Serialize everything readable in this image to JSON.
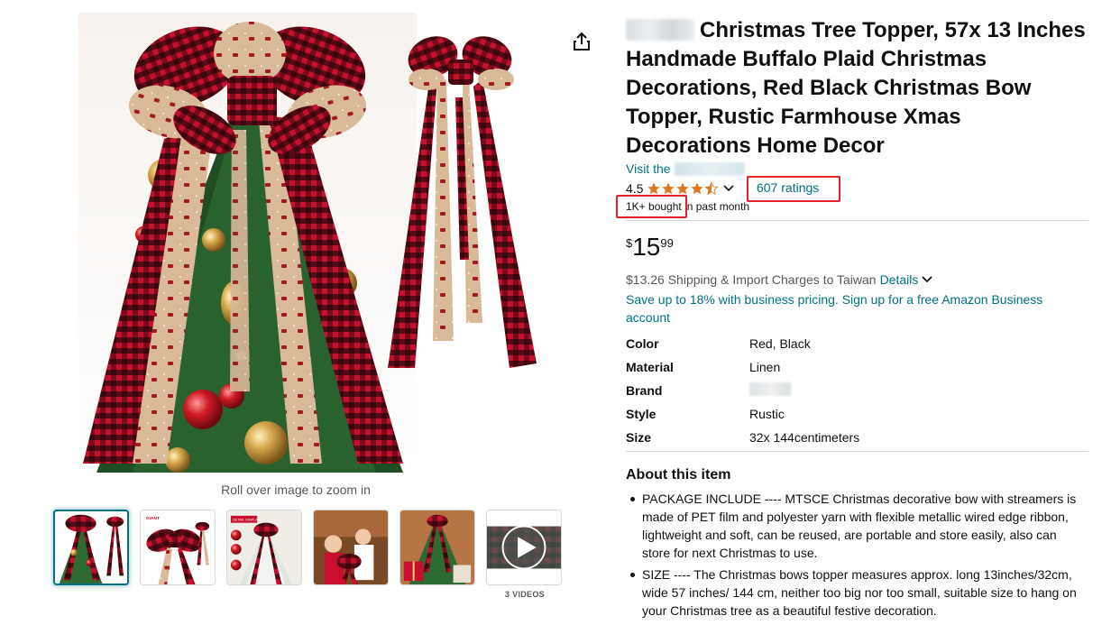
{
  "gallery": {
    "zoom_hint": "Roll over image to zoom in",
    "thumbnail_badges": [
      "GIANT",
      "DETAIL DISPLAY"
    ],
    "videos_label": "3 VIDEOS",
    "thumbnails": [
      "bow-topper-tree",
      "bow-detail",
      "detail-display",
      "family-decorating",
      "gift-scene",
      "video"
    ]
  },
  "product": {
    "title": "Christmas Tree Topper, 57x 13 Inches Handmade Buffalo Plaid Christmas Decorations, Red Black Christmas Bow Topper, Rustic Farmhouse Xmas Decorations Home Decor",
    "visit_store": "Visit the",
    "rating_value": "4.5",
    "ratings_link": "607 ratings",
    "bought_badge": "1K+ bought",
    "bought_suffix": " in past month",
    "price": {
      "symbol": "$",
      "whole": "15",
      "fraction": "99"
    },
    "shipping": "$13.26 Shipping & Import Charges to Taiwan",
    "shipping_details": "Details",
    "business_offer": "Save up to 18% with business pricing. Sign up for a free Amazon Business account"
  },
  "specs": [
    {
      "key": "Color",
      "value": "Red, Black"
    },
    {
      "key": "Material",
      "value": "Linen"
    },
    {
      "key": "Brand",
      "value": ""
    },
    {
      "key": "Style",
      "value": "Rustic"
    },
    {
      "key": "Size",
      "value": "32x 144centimeters"
    }
  ],
  "about": {
    "title": "About this item",
    "bullets": [
      "PACKAGE INCLUDE ---- MTSCE Christmas decorative bow with streamers is made of PET film and polyester yarn with flexible metallic wired edge ribbon, lightweight and soft, can be reused, are portable and store easily, also can store for next Christmas to use.",
      "SIZE ---- The Christmas bows topper measures approx. long 13inches/32cm, wide 57 inches/ 144 cm, neither too big nor too small, suitable size to hang on your Christmas tree as a beautiful festive decoration."
    ]
  },
  "colors": {
    "link": "#007185",
    "highlight_box": "#e4212b",
    "star": "#de7921",
    "text": "#0f1111",
    "muted": "#565959"
  },
  "icons": [
    "share-icon",
    "star-icon",
    "chevron-down-icon",
    "play-icon"
  ]
}
